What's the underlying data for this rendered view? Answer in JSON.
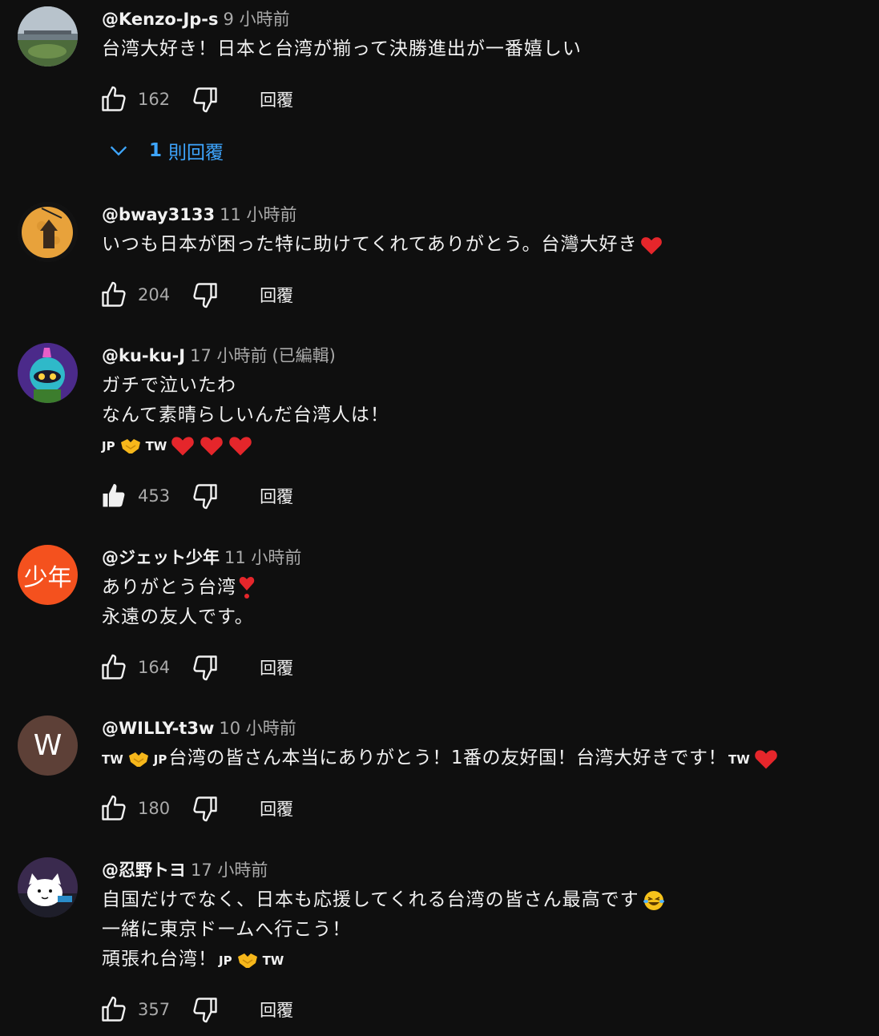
{
  "reply_label": "回覆",
  "comments": [
    {
      "author": "@Kenzo-Jp-s",
      "time": "9 小時前",
      "lines": [
        "台湾大好き！日本と台湾が揃って決勝進出が一番嬉しい"
      ],
      "likes": "162",
      "replies_count": "1",
      "replies_label": "則回覆"
    },
    {
      "author": "@bway3133",
      "time": "11 小時前",
      "lines": [
        "いつも日本が困った特に助けてくれてありがとう。台灣大好き"
      ],
      "likes": "204"
    },
    {
      "author": "@ku-ku-J",
      "time": "17 小時前",
      "edited": "(已編輯)",
      "lines": [
        "ガチで泣いたわ",
        "なんて素晴らしいんだ台湾人は！"
      ],
      "flags": [
        "JP",
        "TW"
      ],
      "likes": "453",
      "liked": true
    },
    {
      "author": "@ジェット少年",
      "time": "11 小時前",
      "avatar_text": "少年",
      "lines": [
        "ありがとう台湾",
        "永遠の友人です。"
      ],
      "likes": "164"
    },
    {
      "author": "@WILLY-t3w",
      "time": "10 小時前",
      "avatar_text": "W",
      "line_parts": [
        "TW",
        "JP",
        "台湾の皆さん本当にありがとう！1番の友好国！台湾大好きです！",
        "TW"
      ],
      "likes": "180"
    },
    {
      "author": "@忍野トヨ",
      "time": "17 小時前",
      "lines": [
        "自国だけでなく、日本も応援してくれる台湾の皆さん最高です",
        "一緒に東京ドームへ行こう！",
        "頑張れ台湾！"
      ],
      "flags": [
        "JP",
        "TW"
      ],
      "likes": "357"
    }
  ],
  "colors": {
    "background": "#0f0f0f",
    "text": "#f1f1f1",
    "secondary_text": "#aaaaaa",
    "link_blue": "#3ea6ff",
    "heart_red": "#e5262b",
    "avatar_orange": "#f4511e",
    "avatar_brown": "#5d4037"
  },
  "icons": [
    "thumbs-up-icon",
    "thumbs-down-icon",
    "chevron-down-icon",
    "heart-icon",
    "handshake-icon",
    "laughing-emoji-icon"
  ]
}
